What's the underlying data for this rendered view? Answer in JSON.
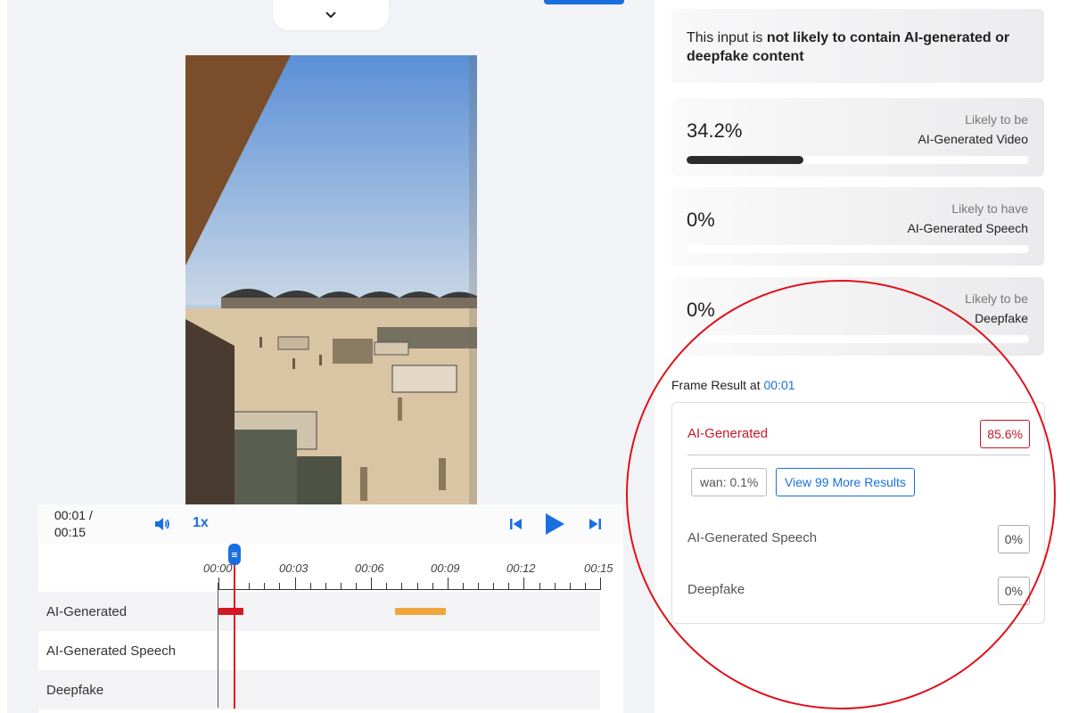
{
  "player": {
    "time_current": "00:01 /",
    "time_total": "00:15",
    "speed": "1x"
  },
  "timeline": {
    "ticks": [
      "00:00",
      "00:03",
      "00:06",
      "00:09",
      "00:12",
      "00:15"
    ],
    "tracks": [
      "AI-Generated",
      "AI-Generated Speech",
      "Deepfake"
    ],
    "playhead": "00:01"
  },
  "summary": {
    "prefix": "This input is ",
    "emphasis": "not likely to contain AI-generated or deepfake content"
  },
  "metrics": [
    {
      "value": "34.2%",
      "fraction": 0.342,
      "caption_1": "Likely to be",
      "caption_2": "AI-Generated Video"
    },
    {
      "value": "0%",
      "fraction": 0,
      "caption_1": "Likely to have",
      "caption_2": "AI-Generated Speech"
    },
    {
      "value": "0%",
      "fraction": 0,
      "caption_1": "Likely to be",
      "caption_2": "Deepfake"
    }
  ],
  "frame_result": {
    "title": "Frame Result at ",
    "time": "00:01",
    "ai_generated_label": "AI-Generated",
    "ai_generated_value": "85.6%",
    "chip_model": "wan: 0.1%",
    "chip_more": "View 99 More Results",
    "speech_label": "AI-Generated Speech",
    "speech_value": "0%",
    "deepfake_label": "Deepfake",
    "deepfake_value": "0%"
  },
  "colors": {
    "accent": "#1a6fe0",
    "alert_red": "#c9162b",
    "segment_red": "#d21a24",
    "segment_orange": "#f0a53a",
    "annotation_red": "#e0101a"
  },
  "icons": {
    "collapse": "chevron-down-icon",
    "volume": "volume-icon",
    "prev": "skip-back-icon",
    "play": "play-icon",
    "next": "skip-forward-icon"
  }
}
